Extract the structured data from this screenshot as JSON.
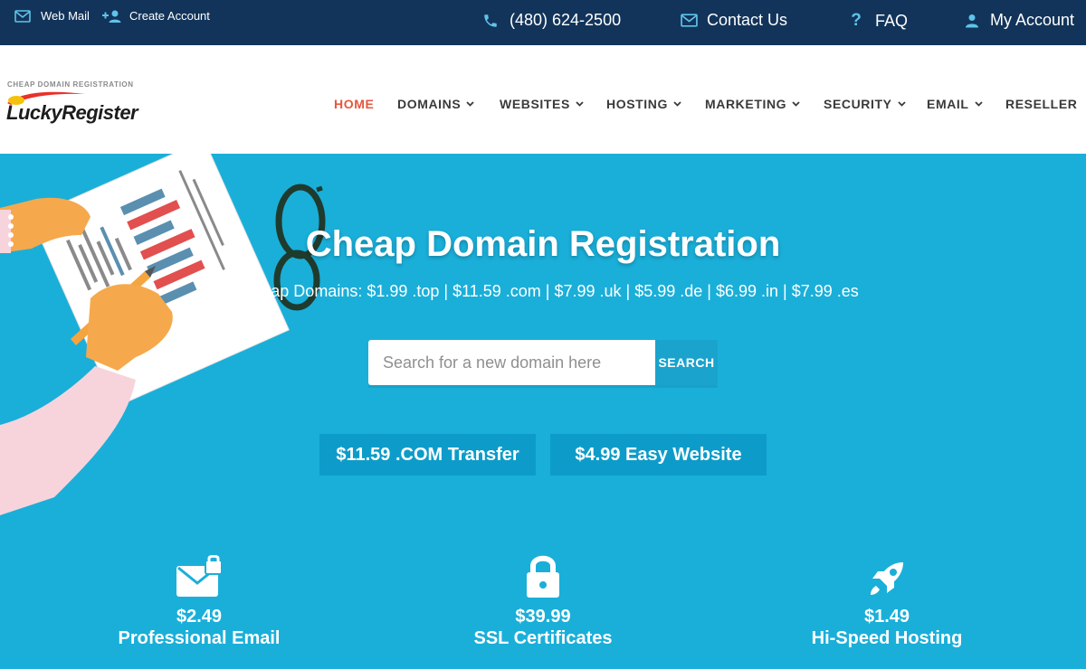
{
  "topbar": {
    "webmail": "Web Mail",
    "create_account": "Create Account",
    "phone": "(480) 624-2500",
    "contact": "Contact Us",
    "faq": "FAQ",
    "my_account": "My Account"
  },
  "logo": {
    "tagline": "CHEAP DOMAIN REGISTRATION",
    "name": "LuckyRegister"
  },
  "nav": {
    "items": [
      {
        "label": "HOME"
      },
      {
        "label": "DOMAINS"
      },
      {
        "label": "WEBSITES"
      },
      {
        "label": "HOSTING"
      },
      {
        "label": "MARKETING"
      },
      {
        "label": "SECURITY"
      },
      {
        "label": "EMAIL"
      },
      {
        "label": "RESELLER"
      }
    ]
  },
  "hero": {
    "title": "Cheap Domain Registration",
    "subtitle": "# Cheap Domains: $1.99 .top | $11.59 .com | $7.99 .uk | $5.99 .de | $6.99 .in | $7.99 .es",
    "search_placeholder": "Search for a new domain here",
    "search_button": "SEARCH",
    "promo_transfer": "$11.59 .COM Transfer",
    "promo_website": "$4.99 Easy Website"
  },
  "features": [
    {
      "price": "$2.49",
      "label": "Professional Email",
      "icon": "email-lock-icon"
    },
    {
      "price": "$39.99",
      "label": "SSL Certificates",
      "icon": "lock-icon"
    },
    {
      "price": "$1.49",
      "label": "Hi-Speed Hosting",
      "icon": "rocket-icon"
    }
  ],
  "colors": {
    "topbar_bg": "#12345a",
    "hero_bg": "#1aafd9",
    "nav_active": "#e4573d",
    "promo_bg": "#0d9cc9"
  }
}
